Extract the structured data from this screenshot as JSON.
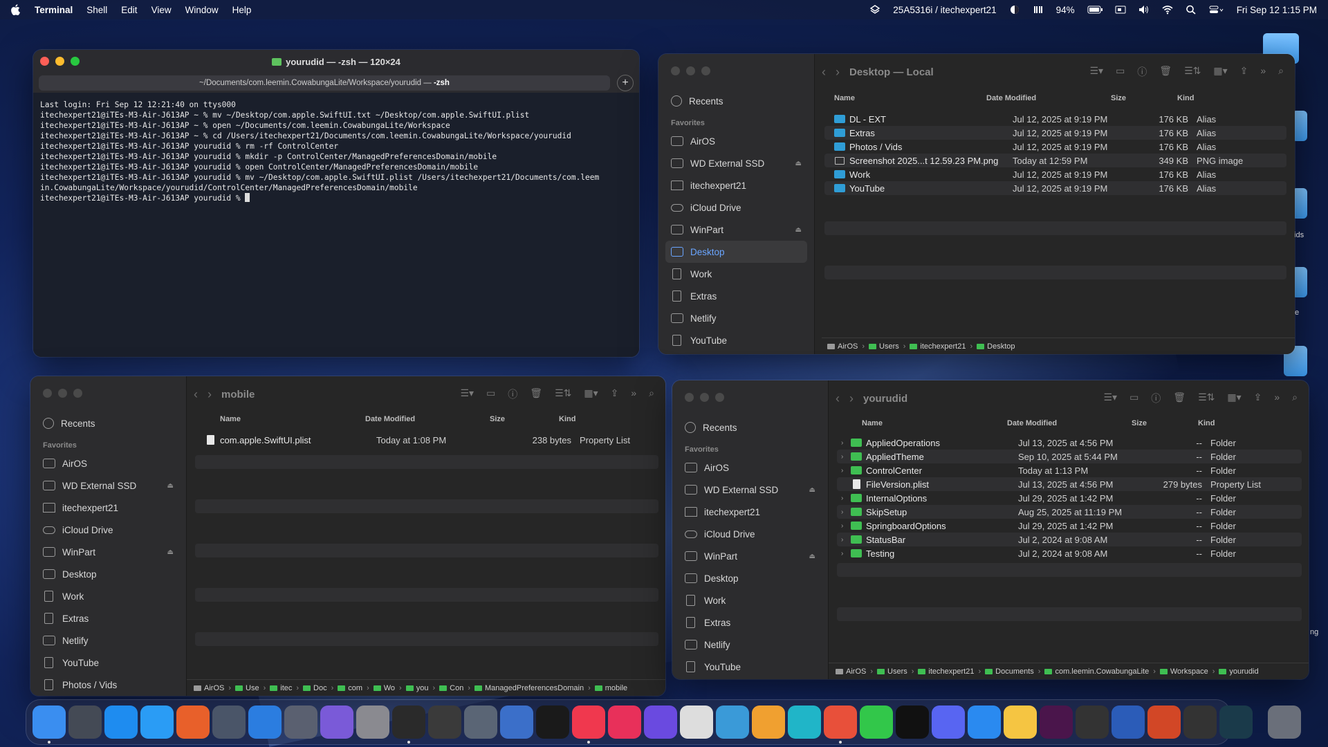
{
  "menubar": {
    "app_name": "Terminal",
    "menus": [
      "Shell",
      "Edit",
      "View",
      "Window",
      "Help"
    ],
    "user_label": "25A5316i / itechexpert21",
    "battery": "94%",
    "datetime": "Fri Sep 12  1:15 PM"
  },
  "desktop": {
    "labels": [
      "/ids",
      "e",
      "ng"
    ]
  },
  "terminal": {
    "title": "yourudid — -zsh — 120×24",
    "tab_path": "~/Documents/com.leemin.CowabungaLite/Workspace/yourudid — ",
    "tab_shell": "-zsh",
    "lines": [
      "Last login: Fri Sep 12 12:21:40 on ttys000",
      "itechexpert21@iTEs-M3-Air-J613AP ~ % mv ~/Desktop/com.apple.SwiftUI.txt ~/Desktop/com.apple.SwiftUI.plist",
      "itechexpert21@iTEs-M3-Air-J613AP ~ % open ~/Documents/com.leemin.CowabungaLite/Workspace",
      "itechexpert21@iTEs-M3-Air-J613AP ~ % cd /Users/itechexpert21/Documents/com.leemin.CowabungaLite/Workspace/yourudid",
      "itechexpert21@iTEs-M3-Air-J613AP yourudid % rm -rf ControlCenter",
      "itechexpert21@iTEs-M3-Air-J613AP yourudid % mkdir -p ControlCenter/ManagedPreferencesDomain/mobile",
      "itechexpert21@iTEs-M3-Air-J613AP yourudid % open ControlCenter/ManagedPreferencesDomain/mobile",
      "itechexpert21@iTEs-M3-Air-J613AP yourudid % mv ~/Desktop/com.apple.SwiftUI.plist /Users/itechexpert21/Documents/com.leem",
      "in.CowabungaLite/Workspace/yourudid/ControlCenter/ManagedPreferencesDomain/mobile",
      "itechexpert21@iTEs-M3-Air-J613AP yourudid % "
    ]
  },
  "finder_desktop": {
    "title": "Desktop — Local",
    "sidebar": {
      "recents": "Recents",
      "favorites_head": "Favorites",
      "items": [
        "AirOS",
        "WD External SSD",
        "itechexpert21",
        "iCloud Drive",
        "WinPart",
        "Desktop",
        "Work",
        "Extras",
        "Netlify",
        "YouTube"
      ]
    },
    "columns": [
      "Name",
      "Date Modified",
      "Size",
      "Kind"
    ],
    "rows": [
      {
        "name": "DL - EXT",
        "date": "Jul 12, 2025 at 9:19 PM",
        "size": "176 KB",
        "kind": "Alias"
      },
      {
        "name": "Extras",
        "date": "Jul 12, 2025 at 9:19 PM",
        "size": "176 KB",
        "kind": "Alias"
      },
      {
        "name": "Photos / Vids",
        "date": "Jul 12, 2025 at 9:19 PM",
        "size": "176 KB",
        "kind": "Alias"
      },
      {
        "name": "Screenshot 2025...t 12.59.23 PM.png",
        "date": "Today at 12:59 PM",
        "size": "349 KB",
        "kind": "PNG image"
      },
      {
        "name": "Work",
        "date": "Jul 12, 2025 at 9:19 PM",
        "size": "176 KB",
        "kind": "Alias"
      },
      {
        "name": "YouTube",
        "date": "Jul 12, 2025 at 9:19 PM",
        "size": "176 KB",
        "kind": "Alias"
      }
    ],
    "path": [
      "AirOS",
      "Users",
      "itechexpert21",
      "Desktop"
    ]
  },
  "finder_mobile": {
    "title": "mobile",
    "sidebar": {
      "recents": "Recents",
      "favorites_head": "Favorites",
      "items": [
        "AirOS",
        "WD External SSD",
        "itechexpert21",
        "iCloud Drive",
        "WinPart",
        "Desktop",
        "Work",
        "Extras",
        "Netlify",
        "YouTube",
        "Photos / Vids"
      ]
    },
    "columns": [
      "Name",
      "Date Modified",
      "Size",
      "Kind"
    ],
    "rows": [
      {
        "name": "com.apple.SwiftUI.plist",
        "date": "Today at 1:08 PM",
        "size": "238 bytes",
        "kind": "Property List"
      }
    ],
    "path": [
      "AirOS",
      "Use",
      "itec",
      "Doc",
      "com",
      "Wo",
      "you",
      "Con",
      "ManagedPreferencesDomain",
      "mobile"
    ]
  },
  "finder_yourudid": {
    "title": "yourudid",
    "sidebar": {
      "recents": "Recents",
      "favorites_head": "Favorites",
      "items": [
        "AirOS",
        "WD External SSD",
        "itechexpert21",
        "iCloud Drive",
        "WinPart",
        "Desktop",
        "Work",
        "Extras",
        "Netlify",
        "YouTube"
      ]
    },
    "columns": [
      "Name",
      "Date Modified",
      "Size",
      "Kind"
    ],
    "rows": [
      {
        "name": "AppliedOperations",
        "date": "Jul 13, 2025 at 4:56 PM",
        "size": "--",
        "kind": "Folder"
      },
      {
        "name": "AppliedTheme",
        "date": "Sep 10, 2025 at 5:44 PM",
        "size": "--",
        "kind": "Folder"
      },
      {
        "name": "ControlCenter",
        "date": "Today at 1:13 PM",
        "size": "--",
        "kind": "Folder"
      },
      {
        "name": "FileVersion.plist",
        "date": "Jul 13, 2025 at 4:56 PM",
        "size": "279 bytes",
        "kind": "Property List"
      },
      {
        "name": "InternalOptions",
        "date": "Jul 29, 2025 at 1:42 PM",
        "size": "--",
        "kind": "Folder"
      },
      {
        "name": "SkipSetup",
        "date": "Aug 25, 2025 at 11:19 PM",
        "size": "--",
        "kind": "Folder"
      },
      {
        "name": "SpringboardOptions",
        "date": "Jul 29, 2025 at 1:42 PM",
        "size": "--",
        "kind": "Folder"
      },
      {
        "name": "StatusBar",
        "date": "Jul 2, 2024 at 9:08 AM",
        "size": "--",
        "kind": "Folder"
      },
      {
        "name": "Testing",
        "date": "Jul 2, 2024 at 9:08 AM",
        "size": "--",
        "kind": "Folder"
      }
    ],
    "path": [
      "AirOS",
      "Users",
      "itechexpert21",
      "Documents",
      "com.leemin.CowabungaLite",
      "Workspace",
      "yourudid"
    ]
  },
  "dock": {
    "apps": [
      {
        "name": "finder-icon",
        "color": "#3a8ef0"
      },
      {
        "name": "launchpad-icon",
        "color": "#444a55"
      },
      {
        "name": "app-store-icon",
        "color": "#1e8cf0"
      },
      {
        "name": "safari-icon",
        "color": "#2a9cf5"
      },
      {
        "name": "firefox-icon",
        "color": "#e8602a"
      },
      {
        "name": "xcode-tools-icon",
        "color": "#4a5568"
      },
      {
        "name": "files-icon",
        "color": "#2b7de0"
      },
      {
        "name": "iphone-mirroring-icon",
        "color": "#5a6070"
      },
      {
        "name": "chatgpt-icon",
        "color": "#7a5ad8"
      },
      {
        "name": "system-settings-icon",
        "color": "#8a8a90"
      },
      {
        "name": "terminal-icon",
        "color": "#2a2a2a"
      },
      {
        "name": "table-app-icon",
        "color": "#3a3a3a"
      },
      {
        "name": "keychain-icon",
        "color": "#5a6575"
      },
      {
        "name": "utility-icon",
        "color": "#3b6fc9"
      },
      {
        "name": "apple-tv-icon",
        "color": "#1a1a1a"
      },
      {
        "name": "music-icon",
        "color": "#f0384e"
      },
      {
        "name": "podcast-icon",
        "color": "#e8305a"
      },
      {
        "name": "shortcuts-icon",
        "color": "#6a4ae0"
      },
      {
        "name": "clapper-icon",
        "color": "#ddd"
      },
      {
        "name": "capture-icon",
        "color": "#3a9ad8"
      },
      {
        "name": "photos-icon",
        "color": "#f0a030"
      },
      {
        "name": "canva-icon",
        "color": "#20b5c8"
      },
      {
        "name": "mirror-icon",
        "color": "#e8503a"
      },
      {
        "name": "messages-icon",
        "color": "#32c74a"
      },
      {
        "name": "x-icon",
        "color": "#111"
      },
      {
        "name": "discord-icon",
        "color": "#5865f2"
      },
      {
        "name": "testflight-icon",
        "color": "#2a8af0"
      },
      {
        "name": "notes-icon",
        "color": "#f5c542"
      },
      {
        "name": "slack-icon",
        "color": "#4a154b"
      },
      {
        "name": "pen-icon",
        "color": "#333"
      },
      {
        "name": "word-icon",
        "color": "#2b5cb8"
      },
      {
        "name": "powerpoint-icon",
        "color": "#d24726"
      },
      {
        "name": "activity-monitor-icon",
        "color": "#333"
      },
      {
        "name": "ai-app-icon",
        "color": "#1a3a4a"
      },
      {
        "name": "draw-icon",
        "color": "#444"
      }
    ]
  }
}
